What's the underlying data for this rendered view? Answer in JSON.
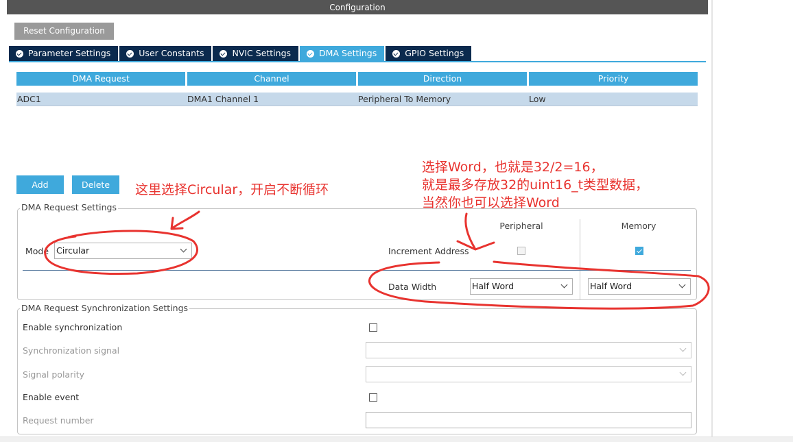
{
  "window": {
    "title": "Configuration"
  },
  "toolbar": {
    "reset_label": "Reset Configuration"
  },
  "tabs": [
    {
      "label": "Parameter Settings",
      "active": false
    },
    {
      "label": "User Constants",
      "active": false
    },
    {
      "label": "NVIC Settings",
      "active": false
    },
    {
      "label": "DMA Settings",
      "active": true
    },
    {
      "label": "GPIO Settings",
      "active": false
    }
  ],
  "dma_table": {
    "columns": [
      "DMA Request",
      "Channel",
      "Direction",
      "Priority"
    ],
    "rows": [
      [
        "ADC1",
        "DMA1 Channel 1",
        "Peripheral To Memory",
        "Low"
      ]
    ],
    "add_label": "Add",
    "delete_label": "Delete"
  },
  "request_settings": {
    "legend": "DMA Request Settings",
    "mode_label": "Mode",
    "mode_value": "Circular",
    "peripheral_header": "Peripheral",
    "memory_header": "Memory",
    "increment_label": "Increment Address",
    "peripheral_increment": false,
    "memory_increment": true,
    "data_width_label": "Data Width",
    "peripheral_width": "Half Word",
    "memory_width": "Half Word"
  },
  "sync_settings": {
    "legend": "DMA Request Synchronization Settings",
    "enable_sync_label": "Enable synchronization",
    "enable_sync": false,
    "sync_signal_label": "Synchronization signal",
    "sync_signal_value": "",
    "signal_polarity_label": "Signal polarity",
    "signal_polarity_value": "",
    "enable_event_label": "Enable event",
    "enable_event": false,
    "request_number_label": "Request number",
    "request_number_value": ""
  },
  "annotations": {
    "mode_note": "这里选择Circular，开启不断循环",
    "width_note_lines": [
      "选择Word，也就是32/2=16，",
      "就是最多存放32的uint16_t类型数据，",
      "当然你也可以选择Word"
    ],
    "color": "#e8332f"
  },
  "colors": {
    "accent": "#3fa9dc",
    "tab_dark": "#0b2a4e",
    "title_bar": "#555555",
    "row_selected": "#c6d9ea",
    "reset_button": "#9a9a9a"
  }
}
